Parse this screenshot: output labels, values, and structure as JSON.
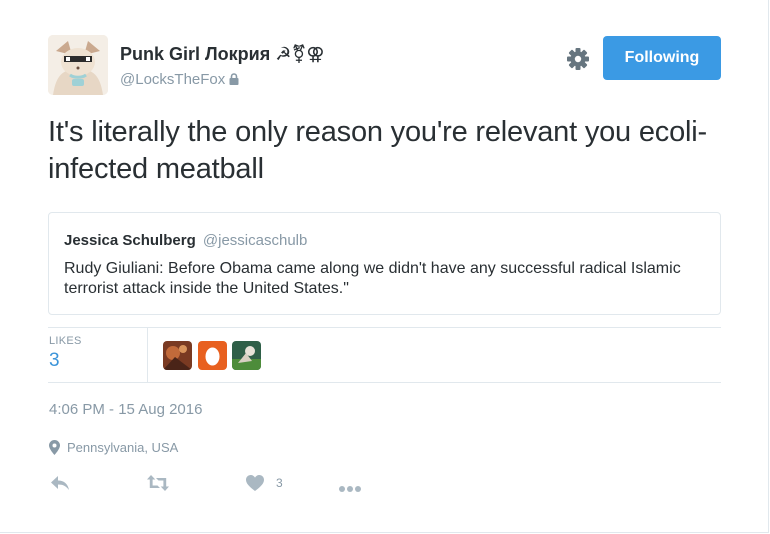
{
  "user": {
    "display_name": "Punk Girl Локрия ☭⚧⚢",
    "screen_name": "@LocksTheFox",
    "protected": true
  },
  "header": {
    "settings_icon": "gear-icon",
    "follow_label": "Following"
  },
  "tweet": {
    "text": "It's literally the only reason you're relevant you ecoli-infected meatball"
  },
  "quote": {
    "name": "Jessica Schulberg",
    "handle": "@jessicaschulb",
    "text": "Rudy Giuliani: Before Obama came along we didn't have any successful radical Islamic terrorist attack inside the United States.\""
  },
  "stats": {
    "likes_label": "LIKES",
    "likes_count": "3",
    "liker_avatars": [
      "avatar-1",
      "avatar-2-egg",
      "avatar-3"
    ]
  },
  "meta": {
    "timestamp": "4:06 PM - 15 Aug 2016",
    "location": "Pennsylvania, USA"
  },
  "actions": {
    "reply_icon": "reply-icon",
    "retweet_icon": "retweet-icon",
    "like_icon": "heart-icon",
    "like_count": "3",
    "more_icon": "more-icon"
  },
  "colors": {
    "accent": "#3b9ae4",
    "link": "#3b94d9",
    "muted": "#8899a6",
    "border": "#e1e8ed"
  }
}
